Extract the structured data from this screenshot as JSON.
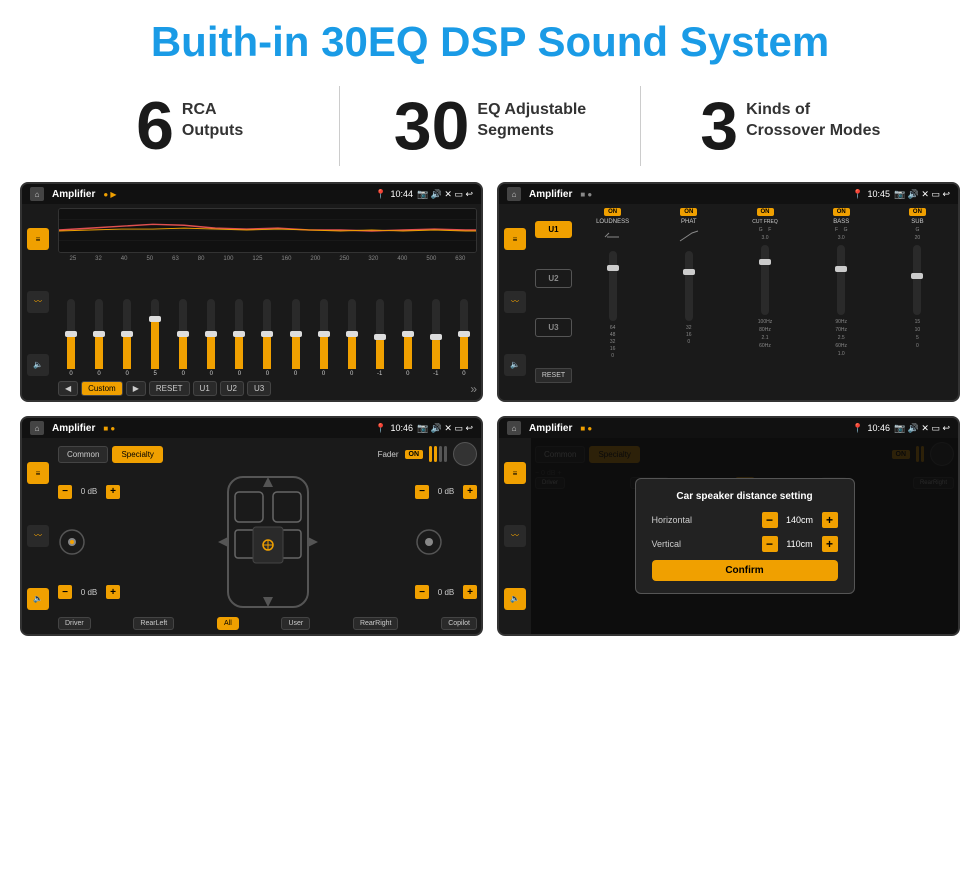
{
  "header": {
    "title": "Buith-in 30EQ DSP Sound System"
  },
  "stats": [
    {
      "number": "6",
      "line1": "RCA",
      "line2": "Outputs"
    },
    {
      "number": "30",
      "line1": "EQ Adjustable",
      "line2": "Segments"
    },
    {
      "number": "3",
      "line1": "Kinds of",
      "line2": "Crossover Modes"
    }
  ],
  "screens": [
    {
      "id": "screen1",
      "status": {
        "time": "10:44",
        "title": "Amplifier"
      },
      "type": "eq"
    },
    {
      "id": "screen2",
      "status": {
        "time": "10:45",
        "title": "Amplifier"
      },
      "type": "crossover"
    },
    {
      "id": "screen3",
      "status": {
        "time": "10:46",
        "title": "Amplifier"
      },
      "type": "speaker"
    },
    {
      "id": "screen4",
      "status": {
        "time": "10:46",
        "title": "Amplifier"
      },
      "type": "dialog",
      "dialog": {
        "title": "Car speaker distance setting",
        "horizontal_label": "Horizontal",
        "horizontal_value": "140cm",
        "vertical_label": "Vertical",
        "vertical_value": "110cm",
        "confirm_label": "Confirm"
      }
    }
  ],
  "eq": {
    "labels": [
      "25",
      "32",
      "40",
      "50",
      "63",
      "80",
      "100",
      "125",
      "160",
      "200",
      "250",
      "320",
      "400",
      "500",
      "630"
    ],
    "values": [
      0,
      0,
      0,
      5,
      0,
      0,
      0,
      0,
      0,
      0,
      0,
      -1,
      0,
      -1,
      0
    ],
    "presets": [
      "Custom",
      "RESET",
      "U1",
      "U2",
      "U3"
    ]
  },
  "crossover": {
    "presets": [
      "U1",
      "U2",
      "U3"
    ],
    "channels": [
      "LOUDNESS",
      "PHAT",
      "CUT FREQ",
      "BASS",
      "SUB"
    ]
  },
  "speaker": {
    "tabs": [
      "Common",
      "Specialty"
    ],
    "fader_label": "Fader",
    "fader_on": "ON",
    "controls": {
      "front_left": "0 dB",
      "front_right": "0 dB",
      "rear_left": "0 dB",
      "rear_right": "0 dB"
    },
    "buttons": [
      "Driver",
      "RearLeft",
      "All",
      "User",
      "RearRight",
      "Copilot"
    ]
  }
}
